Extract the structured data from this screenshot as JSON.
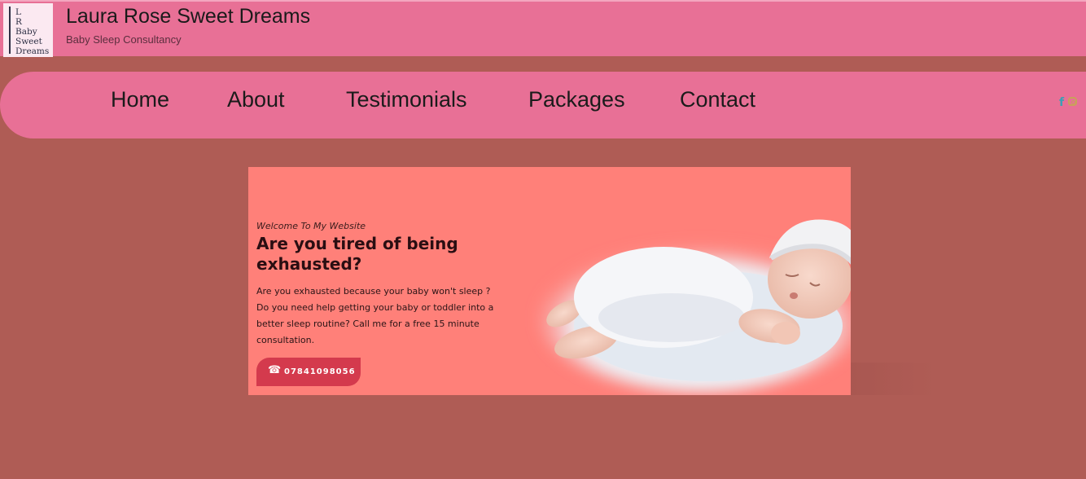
{
  "header": {
    "logo_lines": [
      "L",
      "R",
      "Baby",
      "Sweet",
      "Dreams"
    ],
    "title": "Laura Rose Sweet Dreams",
    "tagline": "Baby Sleep Consultancy"
  },
  "nav": {
    "items": [
      {
        "label": "Home"
      },
      {
        "label": "About"
      },
      {
        "label": "Testimonials"
      },
      {
        "label": "Packages"
      },
      {
        "label": "Contact"
      }
    ],
    "social": [
      {
        "icon": "facebook-icon",
        "glyph": "f"
      },
      {
        "icon": "instagram-icon",
        "glyph": ""
      }
    ]
  },
  "hero": {
    "eyebrow": "Welcome To My Website",
    "heading": "Are you tired of being exhausted?",
    "body": "Are you exhausted because your baby won't sleep ? Do you need help getting your baby or toddler into a better sleep routine? Call me for a free 15 minute consultation.",
    "phone_icon": "☎",
    "phone_number": "07841098056",
    "image_icon": "sleeping-baby-image"
  },
  "colors": {
    "page_bg": "#af5c55",
    "header_bg": "#e87096",
    "hero_bg": "#ff8079",
    "button_bg": "#d43a4d"
  }
}
